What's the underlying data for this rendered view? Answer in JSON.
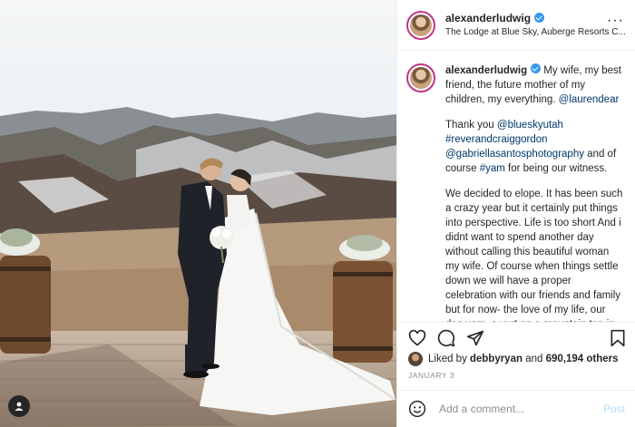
{
  "post": {
    "username": "alexanderludwig",
    "location": "The Lodge at Blue Sky, Auberge Resorts C...",
    "more_icon": "more-horizontal-icon"
  },
  "caption": {
    "username": "alexanderludwig",
    "p1_text": " My wife, my best friend, the future mother of my children, my everything. ",
    "p1_mention": "@laurendear",
    "p2_a": "Thank you ",
    "p2_m1": "@blueskyutah",
    "p2_m2": "#reverandcraiggordon",
    "p2_m3": "@gabriellasantosphotography",
    "p2_b": " and of course ",
    "p2_m4": "#yam",
    "p2_c": " for being our witness.",
    "p3": "We decided to elope. It has been such a crazy year but it certainly put things into perspective. Life is too short And i didnt want to spend another day without calling this beautiful woman my wife. Of course when things settle down we will have a proper celebration with our friends and family but for now- the love of my life, our dog yam, a yurt on a mountain top in the middle of nowhere and chilly temps for"
  },
  "likes": {
    "prefix": "Liked by ",
    "user": "debbyryan",
    "and": " and ",
    "count": "690,194 others"
  },
  "date": "JANUARY 3",
  "comment": {
    "placeholder": "Add a comment...",
    "post_label": "Post"
  },
  "colors": {
    "verified": "#3897f0",
    "link": "#00376b",
    "post_disabled": "#b2dffc",
    "story_ring": "#c13584"
  }
}
